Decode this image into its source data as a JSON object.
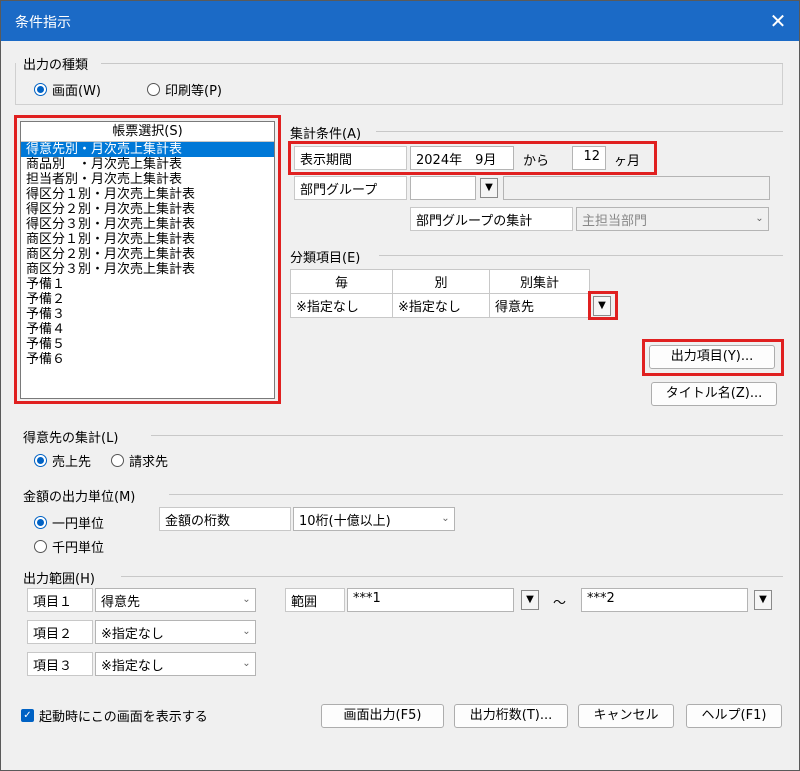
{
  "window": {
    "title": "条件指示",
    "close_glyph": "✕"
  },
  "output_type": {
    "label": "出力の種類",
    "options": [
      {
        "label": "画面(W)",
        "checked": true
      },
      {
        "label": "印刷等(P)",
        "checked": false
      }
    ]
  },
  "report_select": {
    "header": "帳票選択(S)",
    "items": [
      "得意先別・月次売上集計表",
      "商品別　・月次売上集計表",
      "担当者別・月次売上集計表",
      "得区分１別・月次売上集計表",
      "得区分２別・月次売上集計表",
      "得区分３別・月次売上集計表",
      "商区分１別・月次売上集計表",
      "商区分２別・月次売上集計表",
      "商区分３別・月次売上集計表",
      "予備１",
      "予備２",
      "予備３",
      "予備４",
      "予備５",
      "予備６"
    ],
    "selected_index": 0
  },
  "aggregate": {
    "label": "集計条件(A)",
    "period_label": "表示期間",
    "period_value": "2024年　9月",
    "from_label": "から",
    "months_value": "12",
    "months_unit": "ヶ月",
    "dept_group_label": "部門グループ",
    "dept_group_value": "",
    "dept_group_name": "",
    "dept_group_agg_label": "部門グループの集計",
    "dept_group_agg_value": "主担当部門"
  },
  "classification": {
    "label": "分類項目(E)",
    "headers": [
      "毎",
      "別",
      "別集計"
    ],
    "values": [
      "※指定なし",
      "※指定なし",
      "得意先"
    ]
  },
  "buttons": {
    "output_items": "出力項目(Y)...",
    "title_name": "タイトル名(Z)...",
    "screen_output": "画面出力(F5)",
    "output_digits": "出力桁数(T)...",
    "cancel": "キャンセル",
    "help": "ヘルプ(F1)"
  },
  "customer_agg": {
    "label": "得意先の集計(L)",
    "options": [
      {
        "label": "売上先",
        "checked": true
      },
      {
        "label": "請求先",
        "checked": false
      }
    ]
  },
  "amount_unit": {
    "label": "金額の出力単位(M)",
    "options": [
      {
        "label": "一円単位",
        "checked": true
      },
      {
        "label": "千円単位",
        "checked": false
      }
    ],
    "digits_label": "金額の桁数",
    "digits_value": "10桁(十億以上)"
  },
  "output_range": {
    "label": "出力範囲(H)",
    "rows": [
      {
        "label": "項目１",
        "value": "得意先"
      },
      {
        "label": "項目２",
        "value": "※指定なし"
      },
      {
        "label": "項目３",
        "value": "※指定なし"
      }
    ],
    "range_label": "範囲",
    "range_from": "***1",
    "tilde": "～",
    "range_to": "***2"
  },
  "startup_checkbox": {
    "label": "起動時にこの画面を表示する",
    "checked": true
  },
  "icons": {
    "dropdown": "chevron-down-icon",
    "drop_button": "drop-button-icon",
    "close": "close-icon"
  },
  "colors": {
    "titlebar": "#1b6ac6",
    "highlight": "#e02020",
    "selection": "#0078d7"
  }
}
